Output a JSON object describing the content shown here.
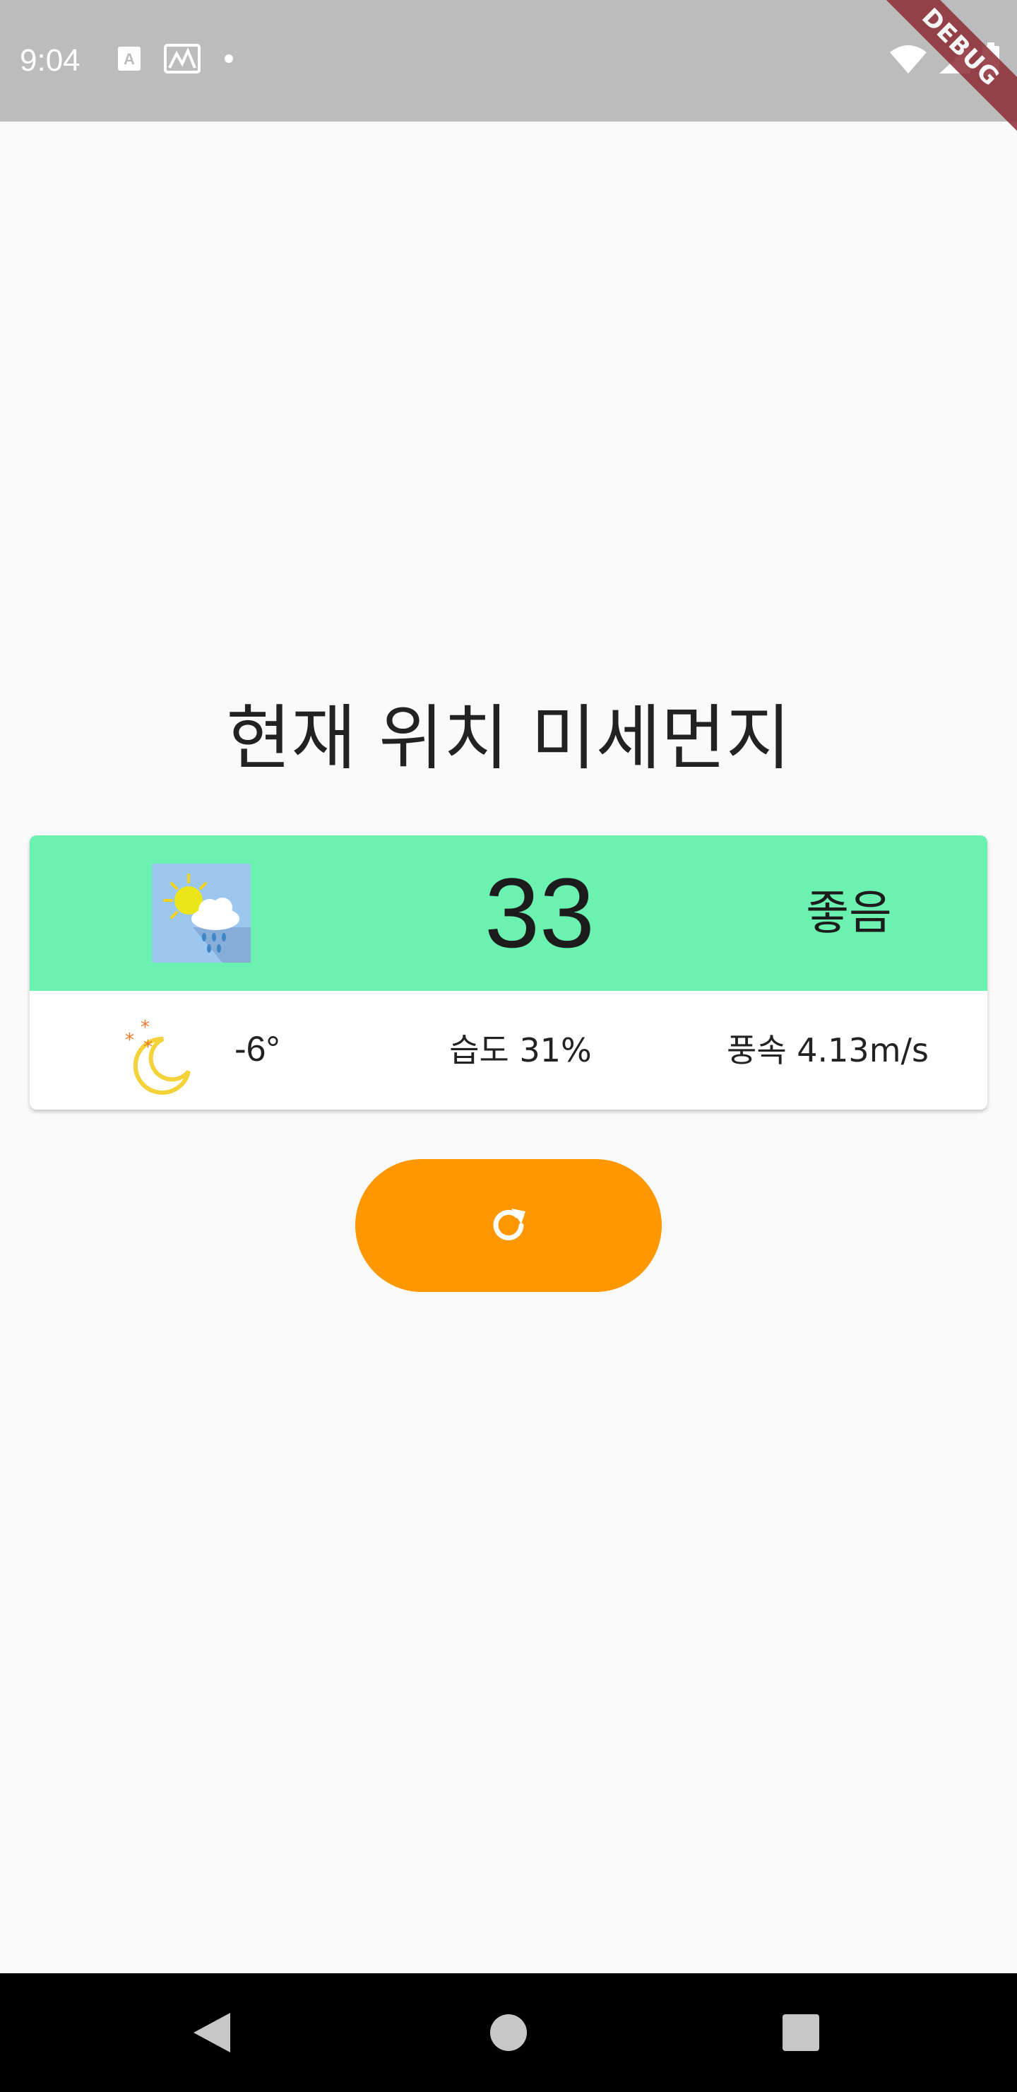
{
  "status_bar": {
    "time": "9:04",
    "icons_left": [
      "font-notification-icon",
      "photos-notification-icon",
      "dot-icon"
    ],
    "icons_right": [
      "wifi-icon",
      "signal-icon",
      "battery-icon"
    ],
    "background": "#bcbcbc"
  },
  "debug_banner": {
    "label": "DEBUG",
    "color": "#8d2b34"
  },
  "main": {
    "title": "현재 위치 미세먼지"
  },
  "card": {
    "air_quality": {
      "weather_icon": "partly-cloudy-rain-icon",
      "value": "33",
      "status": "좋음",
      "background": "#6bf1b0"
    },
    "weather": {
      "condition_icon": "moon-stars-icon",
      "temperature": "-6°",
      "humidity": "습도 31%",
      "wind": "풍속 4.13m/s"
    }
  },
  "refresh_button": {
    "icon": "refresh-icon",
    "color": "#ff9800"
  },
  "nav_bar": {
    "buttons": [
      "back-icon",
      "home-icon",
      "recent-apps-icon"
    ]
  }
}
